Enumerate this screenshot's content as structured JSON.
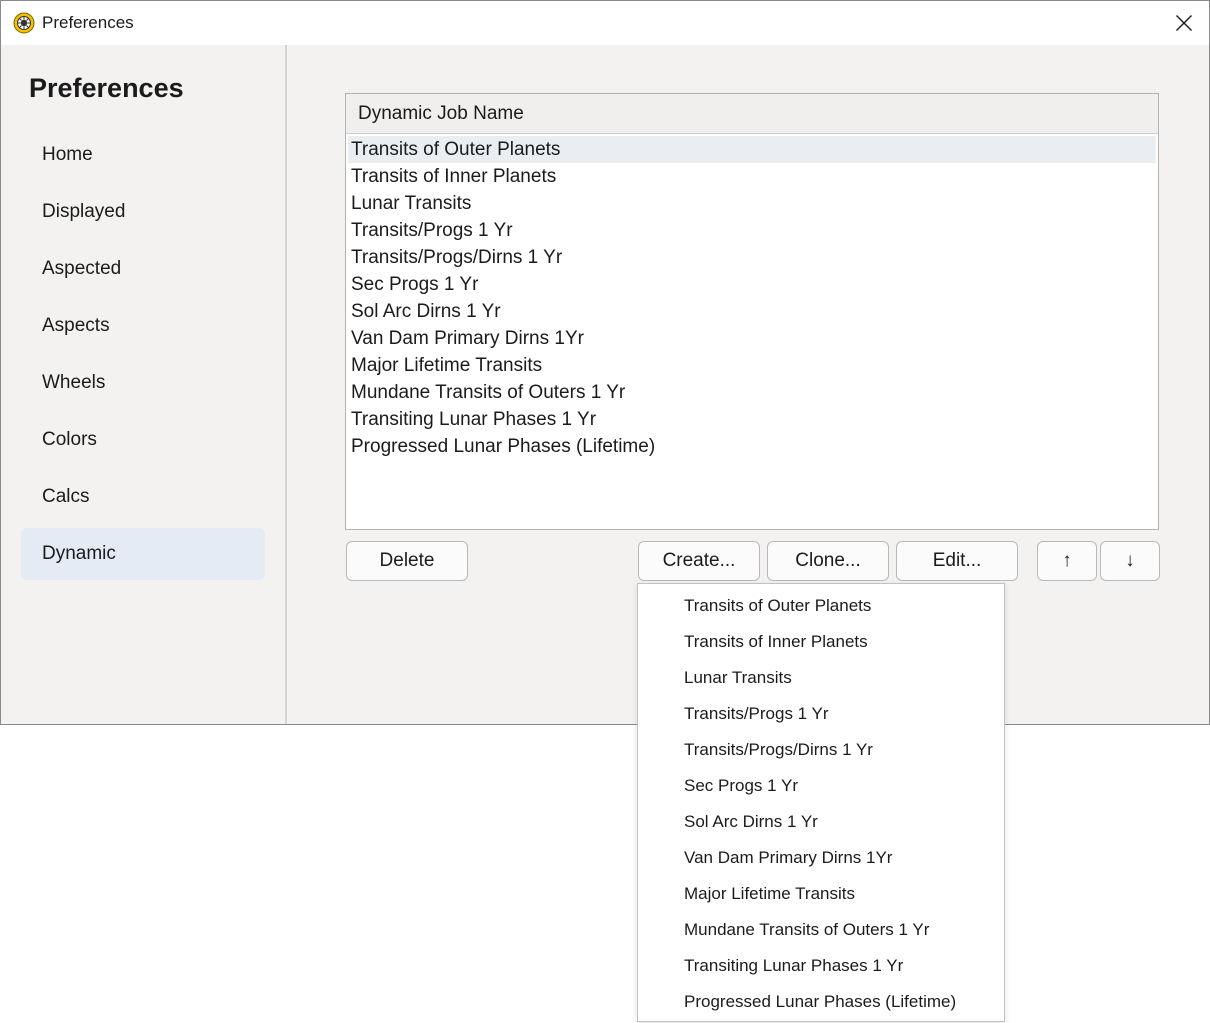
{
  "window": {
    "title": "Preferences",
    "close_symbol": "✕",
    "app_icon": "sun-wheel-icon",
    "close_icon": "close-icon"
  },
  "sidebar": {
    "title": "Preferences",
    "active_item": "Dynamic",
    "active_color": "#e4ebf4",
    "items": [
      {
        "label": "Home"
      },
      {
        "label": "Displayed"
      },
      {
        "label": "Aspected"
      },
      {
        "label": "Aspects"
      },
      {
        "label": "Wheels"
      },
      {
        "label": "Colors"
      },
      {
        "label": "Calcs"
      },
      {
        "label": "Dynamic"
      }
    ]
  },
  "job_list": {
    "column_header": "Dynamic Job Name",
    "selected_row": "Transits of Outer Planets",
    "rows": [
      "Transits of Outer Planets",
      "Transits of Inner Planets",
      "Lunar Transits",
      "Transits/Progs 1 Yr",
      "Transits/Progs/Dirns 1 Yr",
      "Sec Progs 1 Yr",
      "Sol Arc Dirns 1 Yr",
      "Van Dam Primary Dirns 1Yr",
      "Major Lifetime Transits",
      "Mundane Transits of Outers 1 Yr",
      "Transiting Lunar Phases 1 Yr",
      "Progressed Lunar Phases (Lifetime)"
    ]
  },
  "buttons": {
    "delete": "Delete",
    "create": "Create...",
    "clone": "Clone...",
    "edit": "Edit...",
    "move_up": "↑",
    "move_down": "↓"
  },
  "create_menu": {
    "items": [
      "Transits of Outer Planets",
      "Transits of Inner Planets",
      "Lunar Transits",
      "Transits/Progs 1 Yr",
      "Transits/Progs/Dirns 1 Yr",
      "Sec Progs 1 Yr",
      "Sol Arc Dirns 1 Yr",
      "Van Dam Primary Dirns 1Yr",
      "Major Lifetime Transits",
      "Mundane Transits of Outers 1 Yr",
      "Transiting Lunar Phases 1 Yr",
      "Progressed Lunar Phases (Lifetime)"
    ]
  }
}
